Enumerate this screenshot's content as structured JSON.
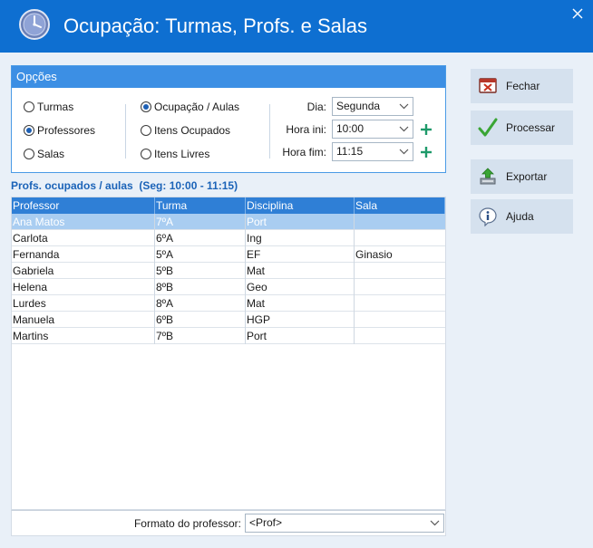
{
  "window": {
    "title": "Ocupação: Turmas, Profs. e Salas",
    "app_icon": "clock-icon",
    "close_icon": "close-icon"
  },
  "options": {
    "header": "Opções",
    "entity_options": [
      {
        "label": "Turmas",
        "selected": false
      },
      {
        "label": "Professores",
        "selected": true
      },
      {
        "label": "Salas",
        "selected": false
      }
    ],
    "view_options": [
      {
        "label": "Ocupação / Aulas",
        "selected": true
      },
      {
        "label": "Itens Ocupados",
        "selected": false
      },
      {
        "label": "Itens Livres",
        "selected": false
      }
    ],
    "day_label": "Dia:",
    "day_value": "Segunda",
    "start_label": "Hora ini:",
    "start_value": "10:00",
    "end_label": "Hora fim:",
    "end_value": "11:15"
  },
  "grid": {
    "title": "Profs. ocupados / aulas  (Seg: 10:00 - 11:15)",
    "columns": [
      "Professor",
      "Turma",
      "Disciplina",
      "Sala"
    ],
    "rows": [
      [
        "Ana Matos",
        "7ºA",
        "Port",
        ""
      ],
      [
        "Carlota",
        "6ºA",
        "Ing",
        ""
      ],
      [
        "Fernanda",
        "5ºA",
        "EF",
        "Ginasio"
      ],
      [
        "Gabriela",
        "5ºB",
        "Mat",
        ""
      ],
      [
        "Helena",
        "8ºB",
        "Geo",
        ""
      ],
      [
        "Lurdes",
        "8ºA",
        "Mat",
        ""
      ],
      [
        "Manuela",
        "6ºB",
        "HGP",
        ""
      ],
      [
        "Martins",
        "7ºB",
        "Port",
        ""
      ]
    ],
    "selected_row": 0
  },
  "footer": {
    "format_label": "Formato do professor:",
    "format_value": "<Prof>"
  },
  "buttons": {
    "close": {
      "label": "Fechar",
      "icon": "close-box-icon"
    },
    "process": {
      "label": "Processar",
      "icon": "checkmark-icon"
    },
    "export": {
      "label": "Exportar",
      "icon": "export-icon"
    },
    "help": {
      "label": "Ajuda",
      "icon": "info-icon"
    }
  },
  "colors": {
    "titlebar": "#0e6fd1",
    "accent": "#3c8fe4",
    "selection": "#a9cdf1",
    "plus": "#1e9a6a"
  }
}
